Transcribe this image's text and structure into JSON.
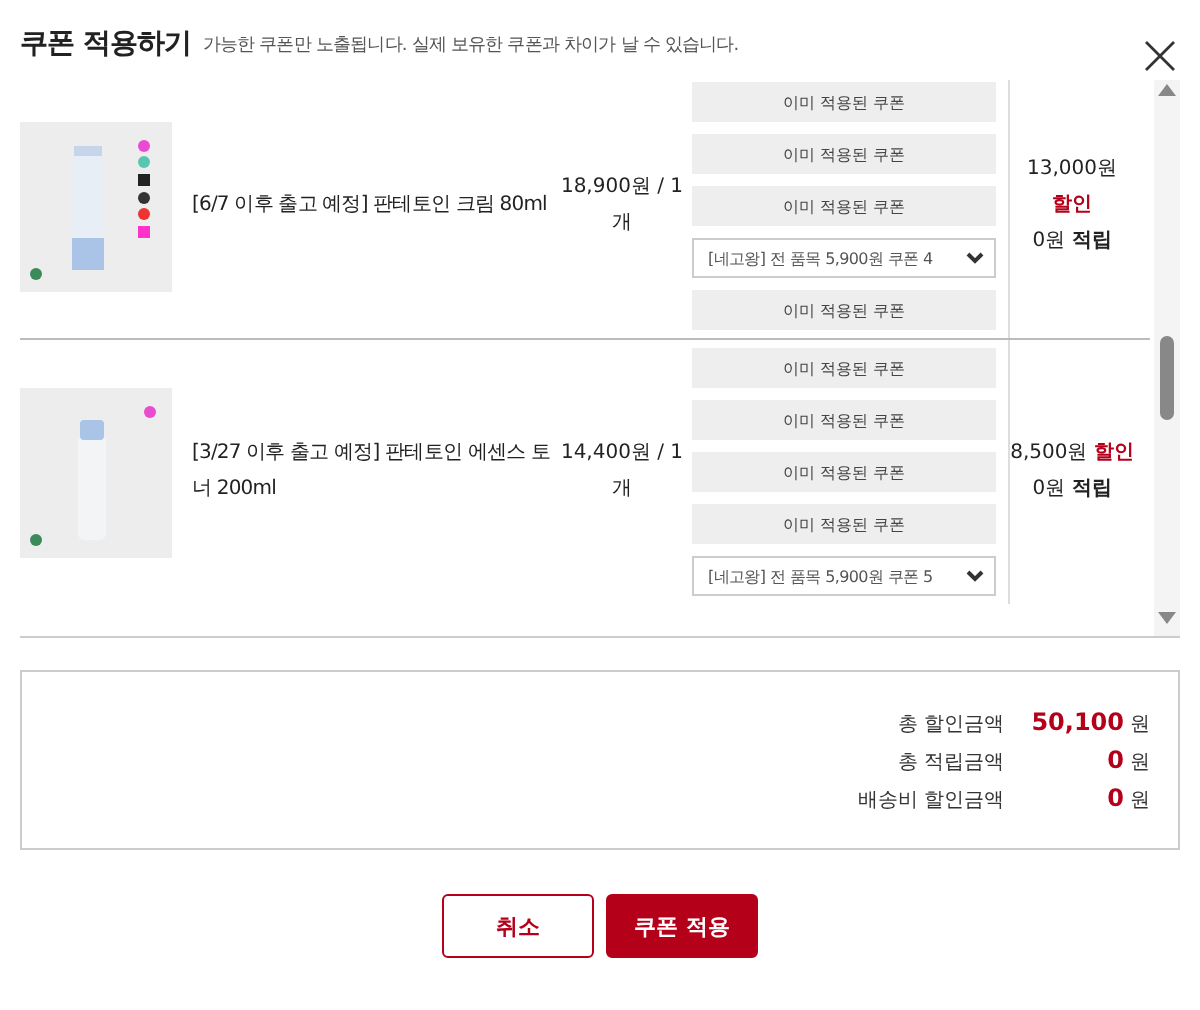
{
  "header": {
    "title": "쿠폰 적용하기",
    "subtitle": "가능한 쿠폰만 노출됩니다. 실제 보유한 쿠폰과 차이가 날 수 있습니다."
  },
  "products": [
    {
      "name": "[6/7 이후 출고 예정] 판테토인 크림 80ml",
      "price": "18,900원 / 1 개",
      "coupons": [
        {
          "kind": "applied",
          "label": "이미 적용된 쿠폰"
        },
        {
          "kind": "applied",
          "label": "이미 적용된 쿠폰"
        },
        {
          "kind": "applied",
          "label": "이미 적용된 쿠폰"
        },
        {
          "kind": "select",
          "label": "[네고왕] 전 품목 5,900원 쿠폰 4"
        },
        {
          "kind": "applied",
          "label": "이미 적용된 쿠폰"
        }
      ],
      "discount": "13,000원",
      "discount_label": "할인",
      "points": "0원",
      "points_label": "적립"
    },
    {
      "name": "[3/27 이후 출고 예정] 판테토인 에센스 토너 200ml",
      "price": "14,400원 / 1 개",
      "coupons": [
        {
          "kind": "applied",
          "label": "이미 적용된 쿠폰"
        },
        {
          "kind": "applied",
          "label": "이미 적용된 쿠폰"
        },
        {
          "kind": "applied",
          "label": "이미 적용된 쿠폰"
        },
        {
          "kind": "applied",
          "label": "이미 적용된 쿠폰"
        },
        {
          "kind": "select",
          "label": "[네고왕] 전 품목 5,900원 쿠폰 5"
        }
      ],
      "discount": "8,500원",
      "discount_label": "할인",
      "points": "0원",
      "points_label": "적립"
    }
  ],
  "summary": [
    {
      "label": "총 할인금액",
      "value": "50,100",
      "unit": "원"
    },
    {
      "label": "총 적립금액",
      "value": "0",
      "unit": "원"
    },
    {
      "label": "배송비 할인금액",
      "value": "0",
      "unit": "원"
    }
  ],
  "buttons": [
    {
      "kind": "secondary",
      "label": "취소"
    },
    {
      "kind": "primary",
      "label": "쿠폰 적용"
    }
  ]
}
